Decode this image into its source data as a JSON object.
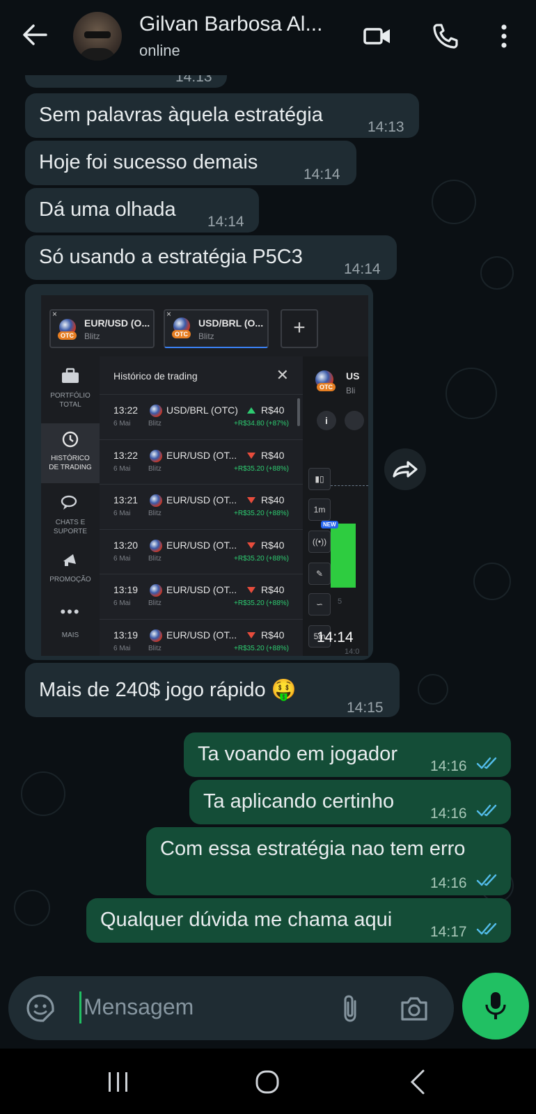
{
  "header": {
    "contact_name": "Gilvan Barbosa Al...",
    "status": "online"
  },
  "messages": {
    "partial_time": "14:13",
    "m1": {
      "text": "Sem palavras àquela estratégia",
      "time": "14:13"
    },
    "m2": {
      "text": "Hoje foi sucesso demais",
      "time": "14:14"
    },
    "m3": {
      "text": "Dá uma olhada",
      "time": "14:14"
    },
    "m4": {
      "text": "Só usando a estratégia P5C3",
      "time": "14:14"
    },
    "image_time": "14:14",
    "m5": {
      "text": "Mais de 240$ jogo rápido 🤑",
      "time": "14:15"
    },
    "o1": {
      "text": "Ta voando em jogador",
      "time": "14:16"
    },
    "o2": {
      "text": "Ta aplicando certinho",
      "time": "14:16"
    },
    "o3": {
      "text": "Com essa estratégia nao tem erro",
      "time": "14:16"
    },
    "o4": {
      "text": "Qualquer dúvida me chama aqui",
      "time": "14:17"
    }
  },
  "screenshot": {
    "tabs": [
      {
        "name": "EUR/USD (O...",
        "sub": "Blitz"
      },
      {
        "name": "USD/BRL (O...",
        "sub": "Blitz"
      }
    ],
    "otc": "OTC",
    "sidebar": [
      {
        "label1": "PORTFÓLIO",
        "label2": "TOTAL"
      },
      {
        "label1": "HISTÓRICO",
        "label2": "DE TRADING"
      },
      {
        "label1": "CHATS E",
        "label2": "SUPORTE"
      },
      {
        "label1": "PROMOÇÃO",
        "label2": ""
      },
      {
        "label1": "MAIS",
        "label2": ""
      }
    ],
    "history_title": "Histórico de trading",
    "trades": [
      {
        "time": "13:22",
        "date": "6 Mai",
        "type": "Blitz",
        "pair": "USD/BRL (OTC)",
        "amount": "R$40",
        "profit": "+R$34.80 (+87%)",
        "direction": "up"
      },
      {
        "time": "13:22",
        "date": "6 Mai",
        "type": "Blitz",
        "pair": "EUR/USD (OT...",
        "amount": "R$40",
        "profit": "+R$35.20 (+88%)",
        "direction": "down"
      },
      {
        "time": "13:21",
        "date": "6 Mai",
        "type": "Blitz",
        "pair": "EUR/USD (OT...",
        "amount": "R$40",
        "profit": "+R$35.20 (+88%)",
        "direction": "down"
      },
      {
        "time": "13:20",
        "date": "6 Mai",
        "type": "Blitz",
        "pair": "EUR/USD (OT...",
        "amount": "R$40",
        "profit": "+R$35.20 (+88%)",
        "direction": "down"
      },
      {
        "time": "13:19",
        "date": "6 Mai",
        "type": "Blitz",
        "pair": "EUR/USD (OT...",
        "amount": "R$40",
        "profit": "+R$35.20 (+88%)",
        "direction": "down"
      },
      {
        "time": "13:19",
        "date": "6 Mai",
        "type": "Blitz",
        "pair": "EUR/USD (OT...",
        "amount": "R$40",
        "profit": "+R$35.20 (+88%)",
        "direction": "down"
      }
    ],
    "right_panel": {
      "pair": "US",
      "sub": "Bli",
      "btn_1m": "1m",
      "btn_5m": "5m",
      "new_badge": "NEW",
      "faded_1": "5",
      "faded_2": "14:0"
    }
  },
  "input": {
    "placeholder": "Mensagem"
  },
  "colors": {
    "incoming": "#1f2c33",
    "outgoing": "#144d37",
    "accent": "#21c063",
    "read_ticks": "#53bdeb"
  },
  "icons": [
    "back-arrow-icon",
    "video-call-icon",
    "phone-icon",
    "more-vert-icon",
    "sticker-icon",
    "attach-icon",
    "camera-icon",
    "mic-icon",
    "forward-icon",
    "double-check-icon"
  ]
}
